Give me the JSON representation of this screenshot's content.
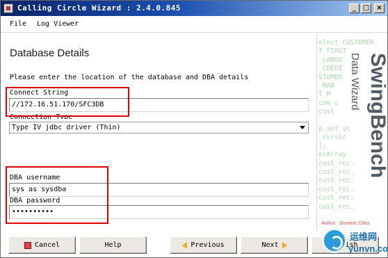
{
  "window": {
    "title": "Calling Circle Wizard : 2.4.0.845",
    "controls": {
      "minimize": "_",
      "maximize": "□",
      "close": "×"
    }
  },
  "menu": {
    "file": "File",
    "log_viewer": "Log Viewer"
  },
  "page": {
    "heading": "Database Details",
    "description": "Please enter the location of the database and DBA details"
  },
  "form": {
    "connect_string_label": "Connect String",
    "connect_string_value": "//172.16.51.170/SFC3DB",
    "connection_type_label": "Connection Type",
    "connection_type_value": "Type IV jdbc driver (Thin)",
    "dba_username_label": "DBA username",
    "dba_username_value": "sys as sysdba",
    "dba_password_label": "DBA password",
    "dba_password_value": "••••••••••"
  },
  "banner": {
    "brand_title": "SwingBench",
    "brand_subtitle": "Data Wizard",
    "author": "Author : Dominic Giles",
    "code_lines": [
      "elect CUSTOMER_",
      "T_FIRST",
      "_LANGU",
      "_CREDI",
      "STOMER",
      "_MAN",
      "T_M",
      "com c",
      "cust",
      "",
      "p.set_sc",
      "_cursor",
      "];",
      "erArray",
      "cust_rec.",
      "cust_rec.",
      "cust_rec.",
      "cust_rec.",
      "cust_rec.",
      "cust_rec."
    ],
    "accent_color": "#4f5b66",
    "code_color": "#a8d8a8"
  },
  "buttons": {
    "cancel": "Cancel",
    "help": "Help",
    "previous": "Previous",
    "next": "Next",
    "finish": "Finish"
  },
  "watermark": {
    "cn": "运维网",
    "url": "yunvn.com"
  },
  "colors": {
    "highlight": "#e00000",
    "titlebar": "#0a246a"
  }
}
